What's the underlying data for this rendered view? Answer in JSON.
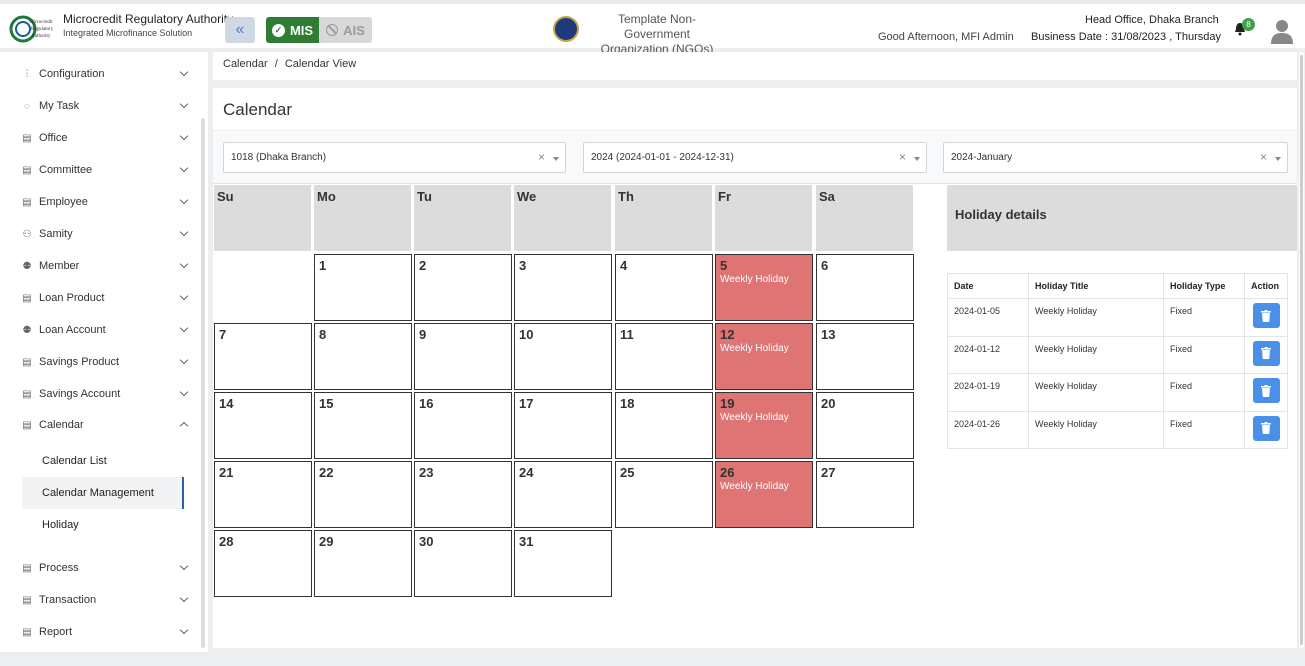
{
  "header": {
    "brand_title": "Microcredit Regulatory Authority",
    "brand_subtitle": "Integrated Microfinance Solution",
    "logo_text": "Microcredit Regulatory Authority",
    "mis_label": "MIS",
    "ais_label": "AIS",
    "org_name_line1": "Template Non-Government",
    "org_name_line2": "Organization (NGOs)",
    "greeting": "Good Afternoon, MFI Admin",
    "branch": "Head Office, Dhaka Branch",
    "business_date": "Business Date : 31/08/2023 , Thursday",
    "notification_count": "8"
  },
  "sidebar": {
    "items": [
      {
        "label": "Configuration",
        "icon": "sliders-icon"
      },
      {
        "label": "My Task",
        "icon": "spinner-icon"
      },
      {
        "label": "Office",
        "icon": "document-icon"
      },
      {
        "label": "Committee",
        "icon": "document-icon"
      },
      {
        "label": "Employee",
        "icon": "document-icon"
      },
      {
        "label": "Samity",
        "icon": "network-icon"
      },
      {
        "label": "Member",
        "icon": "users-icon"
      },
      {
        "label": "Loan Product",
        "icon": "document-icon"
      },
      {
        "label": "Loan Account",
        "icon": "users-icon"
      },
      {
        "label": "Savings Product",
        "icon": "document-icon"
      },
      {
        "label": "Savings Account",
        "icon": "document-icon"
      },
      {
        "label": "Calendar",
        "icon": "document-icon"
      }
    ],
    "calendar_sub": [
      "Calendar List",
      "Calendar Management",
      "Holiday"
    ],
    "bottom_items": [
      {
        "label": "Process",
        "icon": "document-icon"
      },
      {
        "label": "Transaction",
        "icon": "document-icon"
      },
      {
        "label": "Report",
        "icon": "document-icon"
      }
    ]
  },
  "breadcrumb": {
    "parent": "Calendar",
    "separator": "/",
    "current": "Calendar View"
  },
  "page_title": "Calendar",
  "filters": {
    "branch": "1018 (Dhaka Branch)",
    "year": "2024 (2024-01-01 - 2024-12-31)",
    "month": "2024-January",
    "clear": "×"
  },
  "calendar": {
    "weekdays": [
      "Su",
      "Mo",
      "Tu",
      "We",
      "Th",
      "Fr",
      "Sa"
    ],
    "first_weekday_index": 1,
    "days_in_month": 31,
    "holidays": {
      "5": "Weekly Holiday",
      "12": "Weekly Holiday",
      "19": "Weekly Holiday",
      "26": "Weekly Holiday"
    },
    "holiday_color": "#de7474"
  },
  "holiday_details": {
    "title": "Holiday details",
    "columns": [
      "Date",
      "Holiday Title",
      "Holiday Type",
      "Action"
    ],
    "rows": [
      {
        "date": "2024-01-05",
        "title": "Weekly Holiday",
        "type": "Fixed"
      },
      {
        "date": "2024-01-12",
        "title": "Weekly Holiday",
        "type": "Fixed"
      },
      {
        "date": "2024-01-19",
        "title": "Weekly Holiday",
        "type": "Fixed"
      },
      {
        "date": "2024-01-26",
        "title": "Weekly Holiday",
        "type": "Fixed"
      }
    ]
  }
}
